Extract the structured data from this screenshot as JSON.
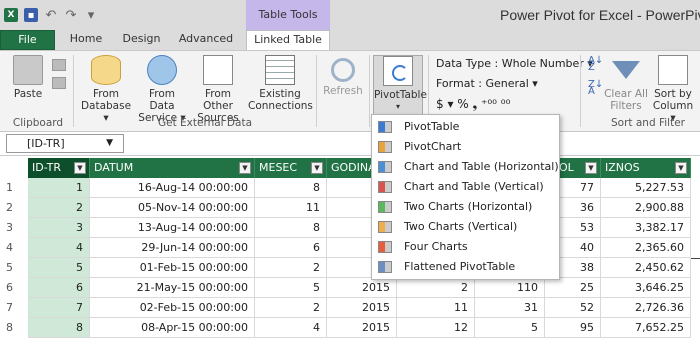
{
  "colors": {
    "excel_green": "#217346",
    "context_tab": "#c6b7ea",
    "header_dark": "#0e4f2b"
  },
  "quick_access": [
    "excel-icon",
    "save-icon",
    "undo-icon",
    "redo-icon",
    "customize-icon"
  ],
  "context_tab_header": "Table Tools",
  "app_title": "Power Pivot for Excel - PowerPivo",
  "tabs": {
    "file": "File",
    "home": "Home",
    "design": "Design",
    "advanced": "Advanced",
    "linked_table": "Linked Table"
  },
  "ribbon": {
    "paste": "Paste",
    "clipboard_group": "Clipboard",
    "from_database": [
      "From",
      "Database ▾"
    ],
    "from_data_service": [
      "From Data",
      "Service ▾"
    ],
    "from_other_sources": [
      "From Other",
      "Sources"
    ],
    "existing_connections": [
      "Existing",
      "Connections"
    ],
    "get_external_data_group": "Get External Data",
    "refresh": "Refresh",
    "pivottable": "PivotTable",
    "data_type": "Data Type : Whole Number ▾",
    "format": "Format : General ▾",
    "format_symbols": "$ ▾  %  ❟  ⁺⁰⁰  ⁰⁰",
    "clear_all_filters": [
      "Clear All",
      "Filters"
    ],
    "sort_by_column": [
      "Sort by",
      "Column ▾"
    ],
    "sort_filter_group": "Sort and Filter"
  },
  "name_box": "[ID-TR]",
  "columns": [
    "ID-TR",
    "DATUM",
    "MESEC",
    "GODINA",
    "OL",
    "IZNOS"
  ],
  "rows": [
    {
      "n": "1",
      "id": "1",
      "datum": "16-Aug-14 00:00:00",
      "mesec": "8",
      "godina": "",
      "c5": "",
      "c6": "",
      "ol": "77",
      "iznos": "5,227.53"
    },
    {
      "n": "2",
      "id": "2",
      "datum": "05-Nov-14 00:00:00",
      "mesec": "11",
      "godina": "",
      "c5": "",
      "c6": "",
      "ol": "36",
      "iznos": "2,900.88"
    },
    {
      "n": "3",
      "id": "3",
      "datum": "13-Aug-14 00:00:00",
      "mesec": "8",
      "godina": "",
      "c5": "",
      "c6": "",
      "ol": "53",
      "iznos": "3,382.17"
    },
    {
      "n": "4",
      "id": "4",
      "datum": "29-Jun-14 00:00:00",
      "mesec": "6",
      "godina": "",
      "c5": "",
      "c6": "",
      "ol": "40",
      "iznos": "2,365.60"
    },
    {
      "n": "5",
      "id": "5",
      "datum": "01-Feb-15 00:00:00",
      "mesec": "2",
      "godina": "",
      "c5": "",
      "c6": "",
      "ol": "38",
      "iznos": "2,450.62"
    },
    {
      "n": "6",
      "id": "6",
      "datum": "21-May-15 00:00:00",
      "mesec": "5",
      "godina": "2015",
      "c5": "2",
      "c6": "110",
      "ol": "25",
      "iznos": "3,646.25"
    },
    {
      "n": "7",
      "id": "7",
      "datum": "02-Feb-15 00:00:00",
      "mesec": "2",
      "godina": "2015",
      "c5": "11",
      "c6": "31",
      "ol": "52",
      "iznos": "2,726.36"
    },
    {
      "n": "8",
      "id": "8",
      "datum": "08-Apr-15 00:00:00",
      "mesec": "4",
      "godina": "2015",
      "c5": "12",
      "c6": "5",
      "ol": "95",
      "iznos": "7,652.25"
    }
  ],
  "pivot_menu": [
    {
      "label": "PivotTable",
      "icon": "pivottable-icon"
    },
    {
      "label": "PivotChart",
      "icon": "pivotchart-icon"
    },
    {
      "label": "Chart and Table (Horizontal)",
      "icon": "chart-table-horizontal-icon"
    },
    {
      "label": "Chart and Table (Vertical)",
      "icon": "chart-table-vertical-icon"
    },
    {
      "label": "Two Charts (Horizontal)",
      "icon": "two-charts-horizontal-icon"
    },
    {
      "label": "Two Charts (Vertical)",
      "icon": "two-charts-vertical-icon"
    },
    {
      "label": "Four Charts",
      "icon": "four-charts-icon"
    },
    {
      "label": "Flattened PivotTable",
      "icon": "flattened-pivottable-icon"
    }
  ]
}
